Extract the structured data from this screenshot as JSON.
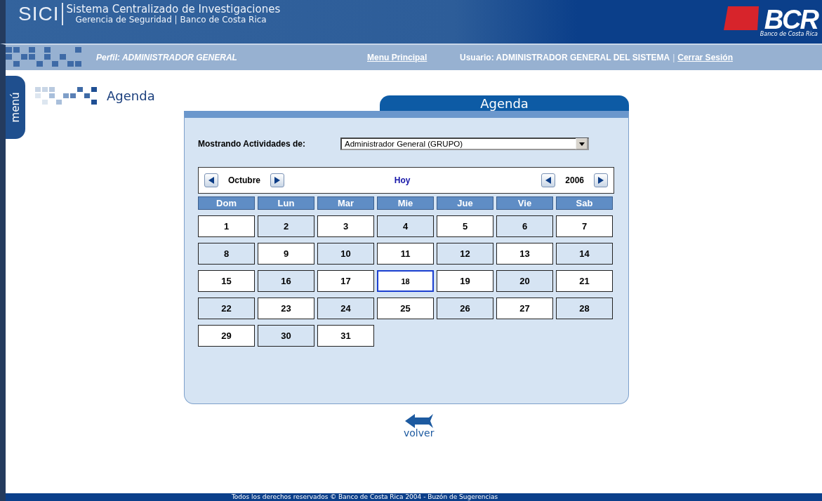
{
  "header": {
    "logo": "SICI",
    "title": "Sistema Centralizado de Investigaciones",
    "subtitle": "Gerencia de Seguridad | Banco de Costa Rica",
    "bank_logo": "BCR",
    "bank_name": "Banco de Costa Rica"
  },
  "nav_bar": {
    "profile": "Perfil: ADMINISTRADOR GENERAL",
    "main_menu": "Menu Principal",
    "user": "Usuario: ADMINISTRADOR GENERAL DEL SISTEMA",
    "separator": "|",
    "logout": "Cerrar Sesión"
  },
  "side_tab": "menú",
  "page_title": "Agenda",
  "panel": {
    "tab_title": "Agenda",
    "filter_label": "Mostrando Actividades de:",
    "filter_value": "Administrador General (GRUPO)",
    "month": "Octubre",
    "today_link": "Hoy",
    "year": "2006",
    "weekdays": [
      "Dom",
      "Lun",
      "Mar",
      "Mie",
      "Jue",
      "Vie",
      "Sab"
    ],
    "weeks": [
      [
        {
          "day": "1",
          "shaded": false,
          "selected": false
        },
        {
          "day": "2",
          "shaded": true,
          "selected": false
        },
        {
          "day": "3",
          "shaded": false,
          "selected": false
        },
        {
          "day": "4",
          "shaded": true,
          "selected": false
        },
        {
          "day": "5",
          "shaded": false,
          "selected": false
        },
        {
          "day": "6",
          "shaded": true,
          "selected": false
        },
        {
          "day": "7",
          "shaded": false,
          "selected": false
        }
      ],
      [
        {
          "day": "8",
          "shaded": true,
          "selected": false
        },
        {
          "day": "9",
          "shaded": false,
          "selected": false
        },
        {
          "day": "10",
          "shaded": true,
          "selected": false
        },
        {
          "day": "11",
          "shaded": false,
          "selected": false
        },
        {
          "day": "12",
          "shaded": true,
          "selected": false
        },
        {
          "day": "13",
          "shaded": false,
          "selected": false
        },
        {
          "day": "14",
          "shaded": true,
          "selected": false
        }
      ],
      [
        {
          "day": "15",
          "shaded": false,
          "selected": false
        },
        {
          "day": "16",
          "shaded": true,
          "selected": false
        },
        {
          "day": "17",
          "shaded": false,
          "selected": false
        },
        {
          "day": "18",
          "shaded": false,
          "selected": true
        },
        {
          "day": "19",
          "shaded": false,
          "selected": false
        },
        {
          "day": "20",
          "shaded": true,
          "selected": false
        },
        {
          "day": "21",
          "shaded": false,
          "selected": false
        }
      ],
      [
        {
          "day": "22",
          "shaded": true,
          "selected": false
        },
        {
          "day": "23",
          "shaded": false,
          "selected": false
        },
        {
          "day": "24",
          "shaded": true,
          "selected": false
        },
        {
          "day": "25",
          "shaded": false,
          "selected": false
        },
        {
          "day": "26",
          "shaded": true,
          "selected": false
        },
        {
          "day": "27",
          "shaded": false,
          "selected": false
        },
        {
          "day": "28",
          "shaded": true,
          "selected": false
        }
      ],
      [
        {
          "day": "29",
          "shaded": false,
          "selected": false
        },
        {
          "day": "30",
          "shaded": true,
          "selected": false
        },
        {
          "day": "31",
          "shaded": false,
          "selected": false
        }
      ]
    ]
  },
  "back_link": "volver",
  "footer": "Todos los derechos reservados © Banco de Costa Rica 2004 - Buzón de Sugerencias"
}
